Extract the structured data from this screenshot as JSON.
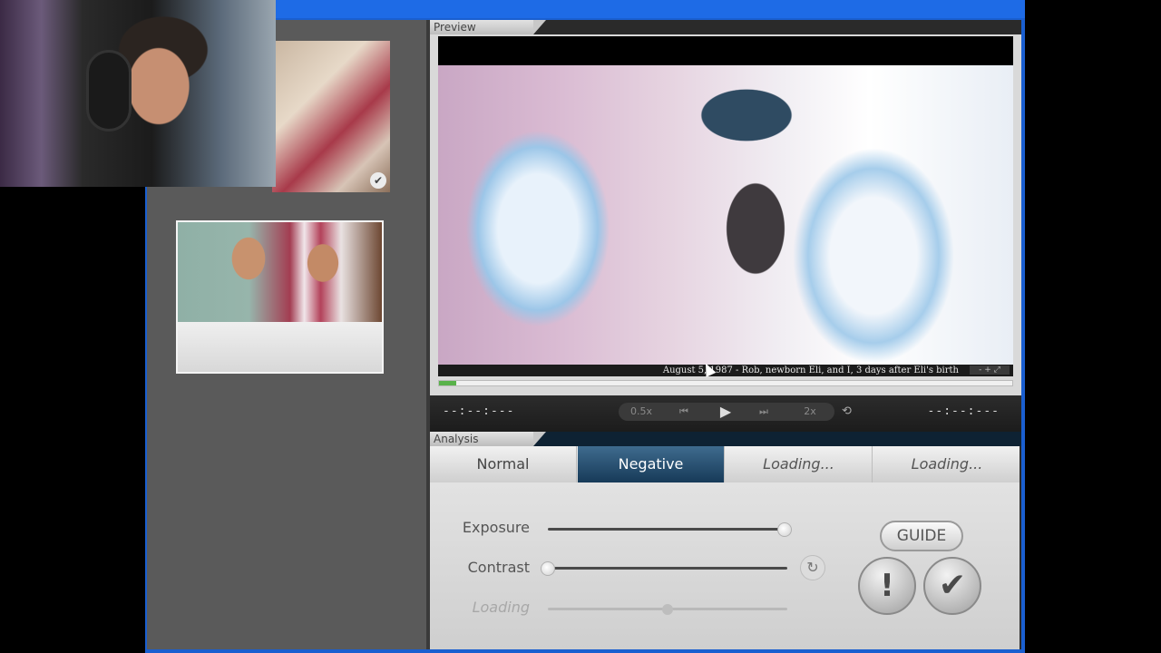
{
  "preview": {
    "section_label": "Preview",
    "caption": "August 5, 1987 - Rob, newborn Eli, and I, 3 days after Eli's birth",
    "caption_controls": "- + ⤢",
    "progress_fraction": 0.03
  },
  "transport": {
    "time_left": "--:--:---",
    "time_right": "--:--:---",
    "speed_slow": "0.5x",
    "speed_fast": "2x",
    "prev_icon": "⏮",
    "play_icon": "▶",
    "next_icon": "⏭",
    "loop_icon": "⟲"
  },
  "analysis": {
    "section_label": "Analysis",
    "tabs": [
      {
        "label": "Normal",
        "active": false
      },
      {
        "label": "Negative",
        "active": true
      },
      {
        "label": "Loading...",
        "active": false
      },
      {
        "label": "Loading...",
        "active": false
      }
    ],
    "sliders": [
      {
        "label": "Exposure",
        "value": 0.99
      },
      {
        "label": "Contrast",
        "value": 0.0
      },
      {
        "label": "Loading",
        "value": 0.5
      }
    ],
    "guide_label": "GUIDE",
    "alert_icon": "!",
    "confirm_icon": "✔",
    "reset_icon": "↻"
  },
  "thumbnails": {
    "check_icon": "✔"
  }
}
